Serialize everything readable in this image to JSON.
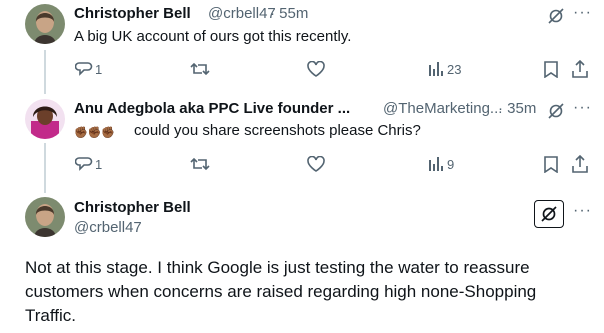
{
  "colors": {
    "text": "#0f1419",
    "muted": "#536471",
    "line": "#cfd9de",
    "accent": "#1d9bf0"
  },
  "tweet1": {
    "name": "Christopher Bell",
    "handle": "@crbell47",
    "time": "· 55m",
    "text": "A big UK account of ours got this recently.",
    "reply_count": "1",
    "views": "23",
    "icons": [
      "grok-icon",
      "more-icon",
      "reply-icon",
      "retweet-icon",
      "like-icon",
      "views-icon",
      "bookmark-icon",
      "share-icon"
    ]
  },
  "tweet2": {
    "name": "Anu Adegbola aka PPC Live founder ...",
    "handle": "@TheMarketing...",
    "time": "· 35m",
    "emoji": "✊🏾✊🏾✊🏾",
    "text": "could you share screenshots please Chris?",
    "reply_count": "1",
    "views": "9"
  },
  "tweet3": {
    "name": "Christopher Bell",
    "handle": "@crbell47",
    "text": "Not at this stage. I think Google is just testing the water to reassure customers when concerns are raised regarding high none-Shopping Traffic."
  }
}
